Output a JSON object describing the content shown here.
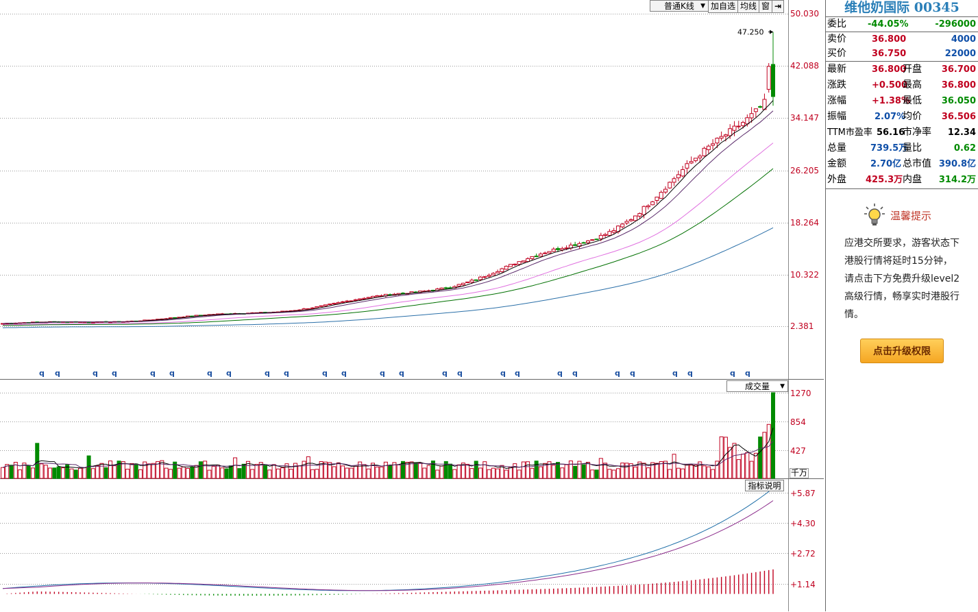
{
  "toolbar": {
    "kline_type": "普通K线",
    "add_watch": "加自选",
    "avg_line": "均线",
    "window": "窗"
  },
  "main_chart": {
    "price_labels": [
      "50.030",
      "42.088",
      "34.147",
      "26.205",
      "18.264",
      "10.322",
      "2.381"
    ],
    "max_marker": "47.250",
    "event_marker": "q"
  },
  "volume_chart": {
    "selector": "成交量",
    "labels": [
      "1270",
      "854",
      "427"
    ],
    "unit": "千万"
  },
  "indicator_chart": {
    "button": "指标说明",
    "labels": [
      "+5.87",
      "+4.30",
      "+2.72",
      "+1.14"
    ]
  },
  "quote": {
    "name": "维他奶国际",
    "code": "00345",
    "committee_ratio_label": "委比",
    "committee_ratio": "-44.05%",
    "committee_diff": "-296000",
    "ask_label": "卖价",
    "ask_price": "36.800",
    "ask_vol": "4000",
    "bid_label": "买价",
    "bid_price": "36.750",
    "bid_vol": "22000",
    "last_label": "最新",
    "last": "36.800",
    "open_label": "开盘",
    "open": "36.700",
    "change_label": "涨跌",
    "change": "+0.500",
    "high_label": "最高",
    "high": "36.800",
    "pct_label": "涨幅",
    "pct": "+1.38%",
    "low_label": "最低",
    "low": "36.050",
    "amp_label": "振幅",
    "amp": "2.07%",
    "avg_label": "均价",
    "avg": "36.506",
    "pe_label": "TTM市盈率",
    "pe": "56.16",
    "pb_label": "市净率",
    "pb": "12.34",
    "vol_label": "总量",
    "vol": "739.5万",
    "vr_label": "量比",
    "vr": "0.62",
    "amount_label": "金额",
    "amount": "2.70亿",
    "mcap_label": "总市值",
    "mcap": "390.8亿",
    "outer_label": "外盘",
    "outer": "425.3万",
    "inner_label": "内盘",
    "inner": "314.2万"
  },
  "notice": {
    "title": "温馨提示",
    "text": "应港交所要求，游客状态下港股行情将延时15分钟，请点击下方免费升级level2高级行情，畅享实时港股行情。",
    "button": "点击升级权限"
  },
  "colors": {
    "up": "#c0001f",
    "down": "#008a00",
    "ma5": "#000000",
    "ma10": "#5a2a6a",
    "ma20": "#e070e0",
    "ma30": "#007000",
    "ma60": "#2a6fa8"
  }
}
